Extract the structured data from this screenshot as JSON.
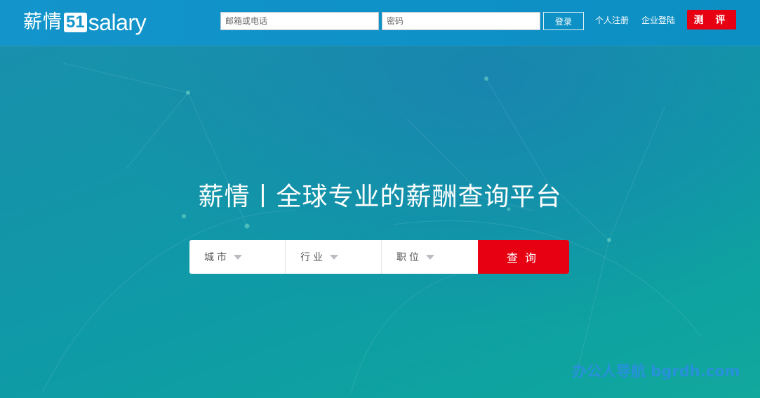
{
  "header": {
    "logo_cn": "薪情",
    "logo_badge": "51",
    "logo_en": "salary",
    "email_placeholder": "邮箱或电话",
    "password_placeholder": "密码",
    "login_label": "登录",
    "personal_register_label": "个人注册",
    "enterprise_login_label": "企业登陆",
    "evaluate_label": "测 评"
  },
  "hero": {
    "title": "薪情丨全球专业的薪酬查询平台"
  },
  "search": {
    "city_label": "城市",
    "industry_label": "行业",
    "position_label": "职位",
    "query_label": "查询"
  },
  "watermark": "办公人导航 bgrdh.com",
  "colors": {
    "header": "#1395cc",
    "accent_red": "#e60012",
    "background": "#0f9aa7"
  },
  "icons": {
    "dropdown": "chevron-down-icon"
  }
}
